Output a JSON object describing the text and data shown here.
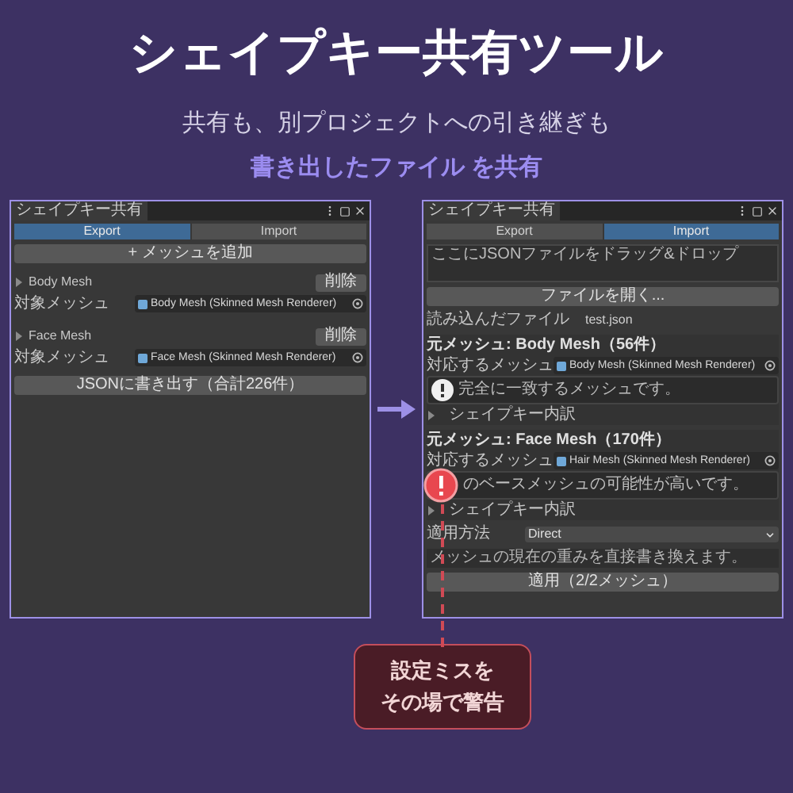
{
  "header": {
    "title": "シェイプキー共有ツール",
    "subtitle": "共有も、別プロジェクトへの引き継ぎも",
    "highlight": "書き出したファイル を共有"
  },
  "panels": [
    {
      "window_title": "シェイプキー共有",
      "tabs": [
        {
          "label": "Export",
          "selected": true
        },
        {
          "label": "Import",
          "selected": false
        }
      ],
      "items": [
        {
          "kind": "button",
          "label": "+ メッシュを追加"
        },
        {
          "kind": "mesh",
          "name": "Body Mesh",
          "remove": "削除",
          "field_label": "対象メッシュ",
          "value": "Body Mesh (Skinned Mesh Renderer)"
        },
        {
          "kind": "mesh",
          "name": "Face Mesh",
          "remove": "削除",
          "field_label": "対象メッシュ",
          "value": "Face Mesh (Skinned Mesh Renderer)"
        },
        {
          "kind": "button",
          "label": "JSONに書き出す（合計226件）"
        }
      ]
    },
    {
      "window_title": "シェイプキー共有",
      "tabs": [
        {
          "label": "Export",
          "selected": false
        },
        {
          "label": "Import",
          "selected": true
        }
      ],
      "items": [
        {
          "kind": "dropzone",
          "text": "ここにJSONファイルをドラッグ&ドロップ"
        },
        {
          "kind": "button",
          "label": "ファイルを開く..."
        },
        {
          "kind": "info",
          "label": "読み込んだファイル",
          "value": "test.json"
        },
        {
          "kind": "source",
          "title": "元メッシュ: Body Mesh（56件）",
          "field_label": "対応するメッシュ",
          "value": "Body Mesh (Skinned Mesh Renderer)",
          "warning": false,
          "message": "完全に一致するメッシュです。",
          "foldout": "シェイプキー内訳"
        },
        {
          "kind": "source",
          "title": "元メッシュ: Face Mesh（170件）",
          "field_label": "対応するメッシュ",
          "value": "Hair Mesh (Skinned Mesh Renderer)",
          "warning": true,
          "message": "のベースメッシュの可能性が高いです。",
          "foldout": "シェイプキー内訳"
        },
        {
          "kind": "dropdown",
          "label": "適用方法",
          "value": "Direct"
        },
        {
          "kind": "note",
          "text": "メッシュの現在の重みを直接書き換えます。"
        },
        {
          "kind": "button",
          "label": "適用（2/2メッシュ）"
        }
      ]
    }
  ],
  "callout": {
    "lines": [
      "設定ミスを",
      "その場で警告"
    ]
  }
}
